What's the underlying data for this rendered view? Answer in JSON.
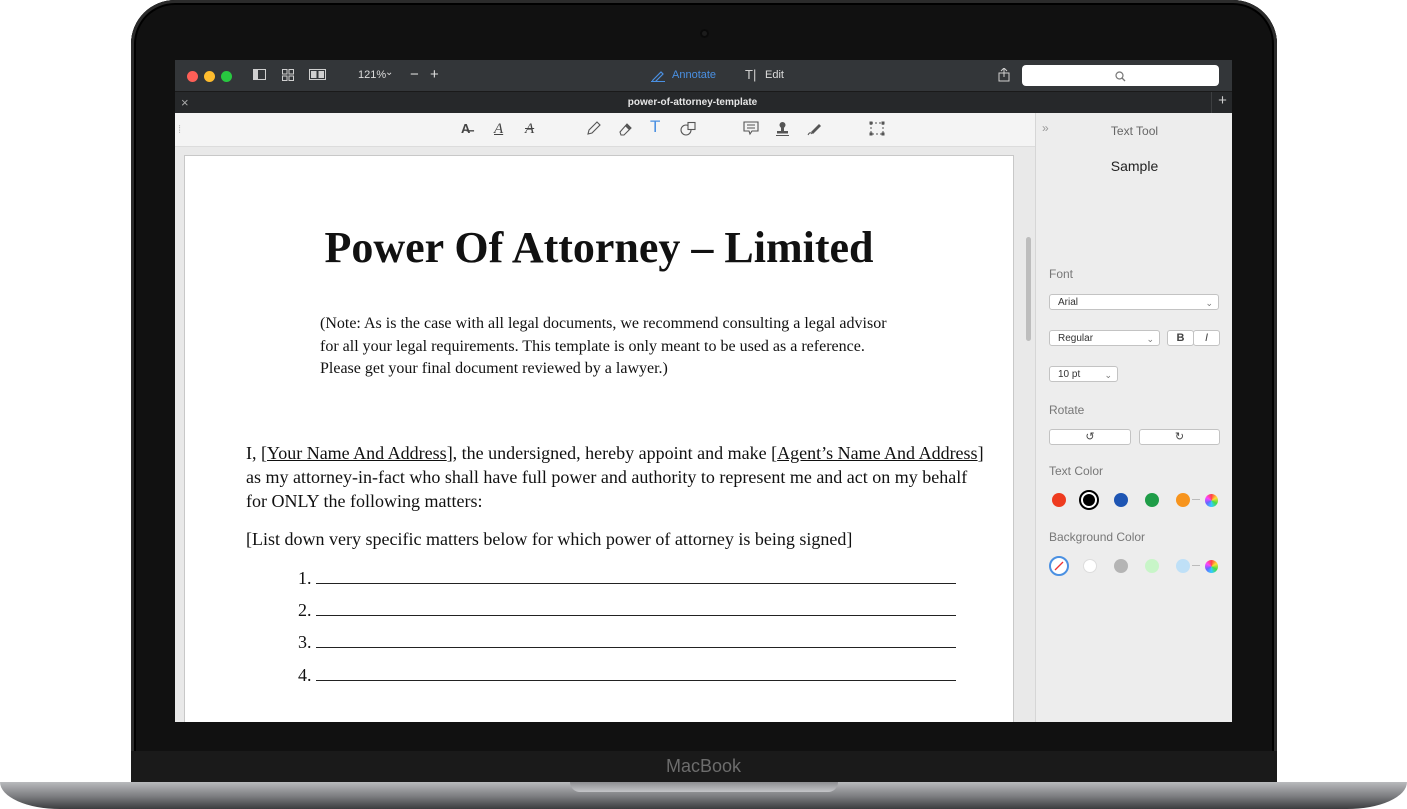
{
  "device": {
    "brand": "MacBook"
  },
  "app": {
    "zoom": "121%",
    "zoom_out": "−",
    "zoom_in": "+",
    "mode_annotate": "Annotate",
    "mode_edit": "Edit",
    "tab_title": "power-of-attorney-template",
    "tab_close": "×",
    "tab_add": "+"
  },
  "document": {
    "title": "Power Of Attorney – Limited",
    "note": "(Note: As is the case with all legal documents, we recommend consulting a legal advisor for all your legal requirements. This template is only meant to be used as a reference. Please get your final document reviewed by a lawyer.)",
    "para_1_a": "I, [",
    "para_1_name": "Your Name And Address",
    "para_1_b": "], the undersigned, hereby appoint and make [",
    "para_1_agent": "Agent’s Name And Address",
    "para_1_c": "] as my attorney-in-fact who shall have full power and authority to represent me and act on my behalf for ONLY the following matters:",
    "list_intro": "[List down very specific matters below for which power of attorney is being signed]",
    "list_numbers": [
      "1.",
      "2.",
      "3.",
      "4."
    ]
  },
  "panel": {
    "title": "Text Tool",
    "sample": "Sample",
    "font_label": "Font",
    "font_value": "Arial",
    "style_value": "Regular",
    "bold_label": "B",
    "italic_label": "I",
    "size_value": "10 pt",
    "rotate_label": "Rotate",
    "text_color_label": "Text Color",
    "bg_color_label": "Background Color",
    "text_colors": [
      "#ee3b1f",
      "#000000",
      "#1e55b3",
      "#1f9d48",
      "#f7941d"
    ],
    "bg_colors": [
      "#ffffff",
      "#b4b4b4",
      "#c8f5c8",
      "#bfe0f7"
    ]
  }
}
